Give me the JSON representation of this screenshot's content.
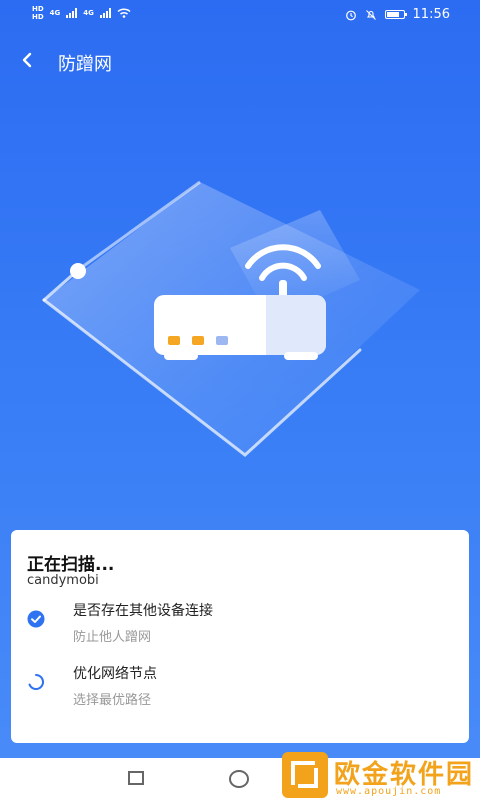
{
  "status_bar": {
    "hd_top": "HD",
    "hd_bottom": "HD",
    "net1": "4G",
    "net2": "4G",
    "time": "11:56"
  },
  "header": {
    "title": "防蹭网"
  },
  "scan_card": {
    "title": "正在扫描...",
    "network_name": "candymobi",
    "items": [
      {
        "title": "是否存在其他设备连接",
        "subtitle": "防止他人蹭网",
        "status": "done"
      },
      {
        "title": "优化网络节点",
        "subtitle": "选择最优路径",
        "status": "loading"
      }
    ]
  },
  "watermark": {
    "text": "欧金软件园",
    "url": "www.apoujin.com"
  },
  "colors": {
    "background": "#2f73f0",
    "accent": "#2f73f0",
    "router_light_orange": "#f5a623",
    "router_light_blue": "#9db8f0",
    "watermark": "#f2a31b"
  }
}
